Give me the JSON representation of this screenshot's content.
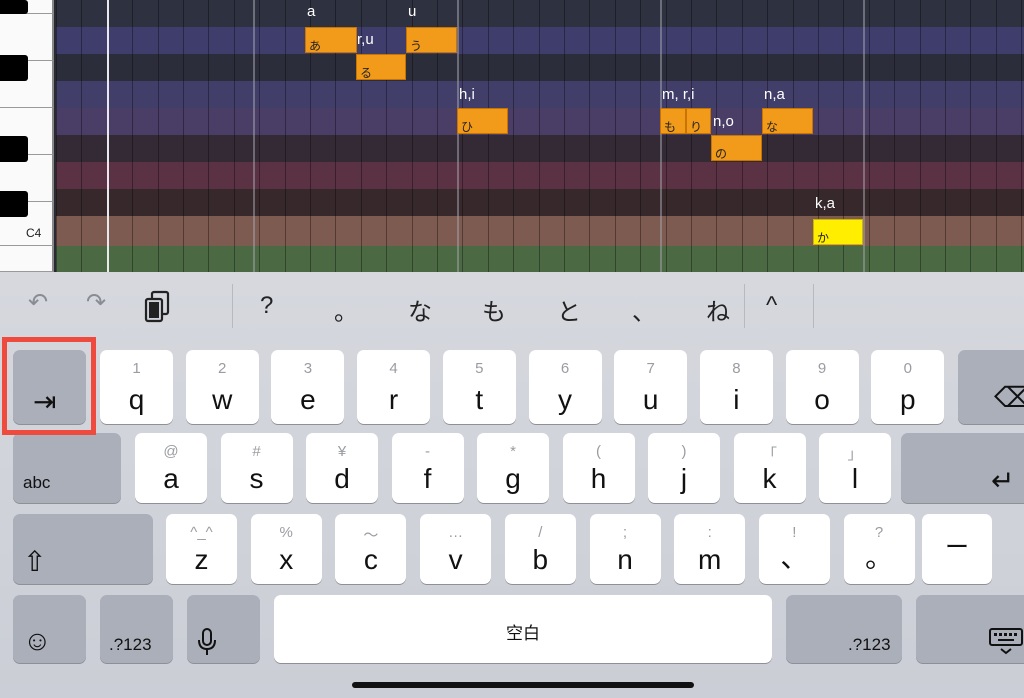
{
  "editor": {
    "octave_label": "C4",
    "notes": [
      {
        "lyric": "a",
        "kana": "あ"
      },
      {
        "lyric": "r,u",
        "kana": "る"
      },
      {
        "lyric": "u",
        "kana": "う"
      },
      {
        "lyric": "h,i",
        "kana": "ひ"
      },
      {
        "lyric": "m, r,i",
        "kana1": "も",
        "kana2": "り"
      },
      {
        "lyric": "n,o",
        "kana": "の"
      },
      {
        "lyric": "n,a",
        "kana": "な"
      },
      {
        "lyric": "k,a",
        "kana": "か"
      }
    ]
  },
  "toolbar": {
    "undo": "↶",
    "redo": "↷",
    "paste": "paste",
    "candidates": [
      "?",
      "。",
      "な",
      "も",
      "と",
      "、",
      "ね"
    ],
    "expand": "^"
  },
  "keys": {
    "row1": [
      {
        "hint": "1",
        "char": "q"
      },
      {
        "hint": "2",
        "char": "w"
      },
      {
        "hint": "3",
        "char": "e"
      },
      {
        "hint": "4",
        "char": "r"
      },
      {
        "hint": "5",
        "char": "t"
      },
      {
        "hint": "6",
        "char": "y"
      },
      {
        "hint": "7",
        "char": "u"
      },
      {
        "hint": "8",
        "char": "i"
      },
      {
        "hint": "9",
        "char": "o"
      },
      {
        "hint": "0",
        "char": "p"
      }
    ],
    "row2": [
      {
        "hint": "@",
        "char": "a"
      },
      {
        "hint": "#",
        "char": "s"
      },
      {
        "hint": "¥",
        "char": "d"
      },
      {
        "hint": "-",
        "char": "f"
      },
      {
        "hint": "*",
        "char": "g"
      },
      {
        "hint": "(",
        "char": "h"
      },
      {
        "hint": ")",
        "char": "j"
      },
      {
        "hint": "「",
        "char": "k"
      },
      {
        "hint": "」",
        "char": "l"
      }
    ],
    "row3": [
      {
        "hint": "^_^",
        "char": "z"
      },
      {
        "hint": "%",
        "char": "x"
      },
      {
        "hint": "〜",
        "char": "c"
      },
      {
        "hint": "…",
        "char": "v"
      },
      {
        "hint": "/",
        "char": "b"
      },
      {
        "hint": ";",
        "char": "n"
      },
      {
        "hint": ":",
        "char": "m"
      },
      {
        "hint": "!",
        "char": "、"
      },
      {
        "hint": "?",
        "char": "。"
      }
    ],
    "tab": "⇥",
    "abc": "abc",
    "shift": "⇧",
    "delete": "⌫",
    "return": "↵",
    "dash": "ー",
    "emoji": "☺",
    "num_left": ".?123",
    "mic": "mic",
    "space": "空白",
    "num_right": ".?123",
    "hide_keyboard": "keyboard"
  }
}
